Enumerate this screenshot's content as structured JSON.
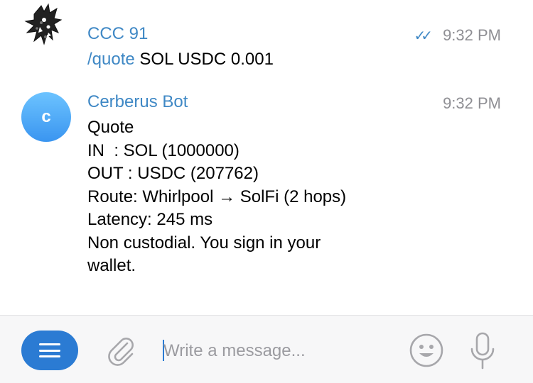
{
  "messages": [
    {
      "sender": "CCC 91",
      "time": "9:32 PM",
      "read_ticks": "✓✓",
      "command": "/quote",
      "args": " SOL USDC 0.001"
    },
    {
      "sender": "Cerberus Bot",
      "avatar_letter": "c",
      "time": "9:32 PM",
      "lines": [
        "Quote",
        "IN  : SOL (1000000)",
        "OUT : USDC (207762)",
        "Route: Whirlpool → SolFi (2 hops)",
        "Latency: 245 ms",
        "Non custodial. You sign in your",
        "wallet."
      ]
    }
  ],
  "composer": {
    "placeholder": "Write a message...",
    "value": ""
  },
  "icons": {
    "menu": "hamburger-menu-icon",
    "attach": "paperclip-icon",
    "emoji": "smiley-icon",
    "voice": "microphone-icon"
  },
  "colors": {
    "accent": "#3f88c5",
    "button": "#2b7bd3",
    "timestamp": "#8e8e93",
    "icon_gray": "#a7a7ab"
  }
}
